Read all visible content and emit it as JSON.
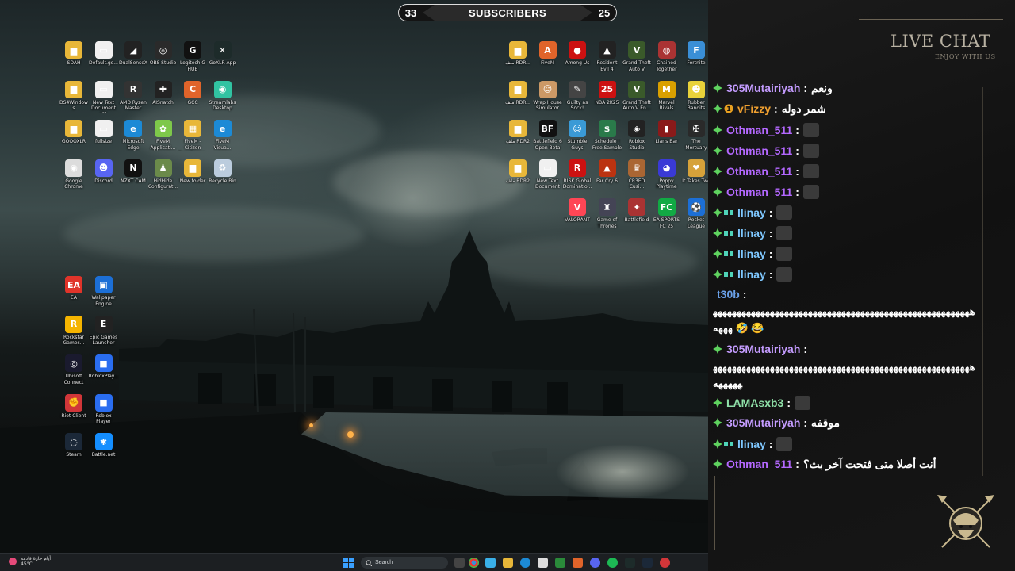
{
  "subscribers": {
    "left_count": "33",
    "label": "SUBSCRIBERS",
    "right_count": "25"
  },
  "desktop": {
    "left_icons": [
      {
        "label": "SDAH",
        "color": "#e8b739",
        "glyph": "▆"
      },
      {
        "label": "Default.go...",
        "color": "#f0f0f0",
        "glyph": "▭"
      },
      {
        "label": "DualSenseX",
        "color": "#222",
        "glyph": "◢"
      },
      {
        "label": "OBS Studio",
        "color": "#2a2a2a",
        "glyph": "◎"
      },
      {
        "label": "Logitech G HUB",
        "color": "#111",
        "glyph": "G"
      },
      {
        "label": "GoXLR App",
        "color": "#1d2b2a",
        "glyph": "✕"
      },
      {
        "label": "DS4Windows",
        "color": "#e8b739",
        "glyph": "▆"
      },
      {
        "label": "New Text Document (2)",
        "color": "#f0f0f0",
        "glyph": "▭"
      },
      {
        "label": "AMD Ryzen Master",
        "color": "#333",
        "glyph": "R"
      },
      {
        "label": "AISnatch",
        "color": "#222",
        "glyph": "✚"
      },
      {
        "label": "GCC",
        "color": "#e0642a",
        "glyph": "C"
      },
      {
        "label": "Streamlabs Desktop",
        "color": "#31c3a2",
        "glyph": "◉"
      },
      {
        "label": "GOOOXLR",
        "color": "#e8b739",
        "glyph": "▆"
      },
      {
        "label": "fullsize",
        "color": "#f0f0f0",
        "glyph": "▭"
      },
      {
        "label": "Microsoft Edge",
        "color": "#1c8ad6",
        "glyph": "e"
      },
      {
        "label": "FiveM Applicati...",
        "color": "#7ec84a",
        "glyph": "✿"
      },
      {
        "label": "FiveM - Citizen Developme...",
        "color": "#e8b739",
        "glyph": "▦"
      },
      {
        "label": "FiveM Visua...",
        "color": "#1c8ad6",
        "glyph": "e"
      },
      {
        "label": "Google Chrome",
        "color": "#dcdcdc",
        "glyph": "◉"
      },
      {
        "label": "Discord",
        "color": "#5865f2",
        "glyph": "☻"
      },
      {
        "label": "NZXT CAM",
        "color": "#111",
        "glyph": "N"
      },
      {
        "label": "HidHide Configurat...",
        "color": "#6b8a4a",
        "glyph": "♟"
      },
      {
        "label": "New folder",
        "color": "#e8b739",
        "glyph": "▆"
      },
      {
        "label": "Recycle Bin",
        "color": "#bcd",
        "glyph": "♻"
      }
    ],
    "launcher_icons": [
      {
        "label": "EA",
        "color": "#e0342a",
        "glyph": "EA"
      },
      {
        "label": "Wallpaper Engine",
        "color": "#1c6fd6",
        "glyph": "▣"
      },
      {
        "label": "Rockstar Games...",
        "color": "#f5b400",
        "glyph": "R"
      },
      {
        "label": "Epic Games Launcher",
        "color": "#222",
        "glyph": "E"
      },
      {
        "label": "Ubisoft Connect",
        "color": "#1a1a2e",
        "glyph": "◎"
      },
      {
        "label": "RobloxPlay...",
        "color": "#2a6df0",
        "glyph": "■"
      },
      {
        "label": "Riot Client",
        "color": "#d13639",
        "glyph": "✊"
      },
      {
        "label": "Roblox Player",
        "color": "#2a6df0",
        "glyph": "■"
      },
      {
        "label": "Steam",
        "color": "#1b2838",
        "glyph": "◌"
      },
      {
        "label": "Battle.net",
        "color": "#148eff",
        "glyph": "✱"
      }
    ],
    "right_icons": [
      {
        "label": "ملف RDR...",
        "color": "#e8b739",
        "glyph": "▆"
      },
      {
        "label": "FiveM",
        "color": "#e0642a",
        "glyph": "A"
      },
      {
        "label": "Among Us",
        "color": "#c11",
        "glyph": "●"
      },
      {
        "label": "Resident Evil 4",
        "color": "#222",
        "glyph": "▲"
      },
      {
        "label": "Grand Theft Auto V",
        "color": "#3a5a2a",
        "glyph": "V"
      },
      {
        "label": "Chained Together",
        "color": "#a33",
        "glyph": "◍"
      },
      {
        "label": "Fortnite",
        "color": "#3a8fd6",
        "glyph": "F"
      },
      {
        "label": "ملف RDR...",
        "color": "#e8b739",
        "glyph": "▆"
      },
      {
        "label": "Wrap House Simulator",
        "color": "#c96",
        "glyph": "☺"
      },
      {
        "label": "Guilty as Sock!",
        "color": "#444",
        "glyph": "✎"
      },
      {
        "label": "NBA 2K25",
        "color": "#c11",
        "glyph": "25"
      },
      {
        "label": "Grand Theft Auto V En...",
        "color": "#3a5a2a",
        "glyph": "V"
      },
      {
        "label": "Marvel Rivals",
        "color": "#d9a000",
        "glyph": "M"
      },
      {
        "label": "Rubber Bandits",
        "color": "#e8d23a",
        "glyph": "☻"
      },
      {
        "label": "ملف RDR2",
        "color": "#e8b739",
        "glyph": "▆"
      },
      {
        "label": "Battlefield 6 Open Beta",
        "color": "#111",
        "glyph": "BF"
      },
      {
        "label": "Stumble Guys",
        "color": "#3a9ad6",
        "glyph": "☺"
      },
      {
        "label": "Schedule I Free Sample",
        "color": "#2a7a4a",
        "glyph": "$"
      },
      {
        "label": "Roblox Studio",
        "color": "#222",
        "glyph": "◈"
      },
      {
        "label": "Liar's Bar",
        "color": "#8a1a1a",
        "glyph": "▮"
      },
      {
        "label": "The Mortuary Assistant",
        "color": "#2a2a2a",
        "glyph": "✠"
      },
      {
        "label": "ملف RDR2",
        "color": "#e8b739",
        "glyph": "▆"
      },
      {
        "label": "New Text Document",
        "color": "#f0f0f0",
        "glyph": "▭"
      },
      {
        "label": "RISK Global Dominatio...",
        "color": "#c11",
        "glyph": "R"
      },
      {
        "label": "Far Cry 6",
        "color": "#b31",
        "glyph": "▲"
      },
      {
        "label": "CR3ED Cusi...",
        "color": "#a63",
        "glyph": "♛"
      },
      {
        "label": "Poppy Playtime",
        "color": "#3a3ad6",
        "glyph": "◕"
      },
      {
        "label": "It Takes Two",
        "color": "#d6a23a",
        "glyph": "❤"
      },
      {
        "label": "VALORANT",
        "color": "#ff4655",
        "glyph": "V"
      },
      {
        "label": "Game of Thrones",
        "color": "#445",
        "glyph": "♜"
      },
      {
        "label": "Battlefield",
        "color": "#a33",
        "glyph": "✦"
      },
      {
        "label": "EA SPORTS FC 25",
        "color": "#1a4",
        "glyph": "FC"
      },
      {
        "label": "Rocket League",
        "color": "#1c6fd6",
        "glyph": "⚽"
      }
    ]
  },
  "chat": {
    "title": "LIVE CHAT",
    "subtitle": "ENJOY WITH US",
    "messages": [
      {
        "user": "305Mutairiyah",
        "color": "#c49cff",
        "text": "ونعم",
        "badge": "gem"
      },
      {
        "user": "vFizzy",
        "color": "#f0a030",
        "text": "شمر دوله",
        "badge": "gem-gold"
      },
      {
        "user": "Othman_511",
        "color": "#b468ff",
        "text": "",
        "badge": "gem",
        "emote": true
      },
      {
        "user": "Othman_511",
        "color": "#b468ff",
        "text": "",
        "badge": "gem",
        "emote": true
      },
      {
        "user": "Othman_511",
        "color": "#b468ff",
        "text": "",
        "badge": "gem",
        "emote": true
      },
      {
        "user": "Othman_511",
        "color": "#b468ff",
        "text": "",
        "badge": "gem",
        "emote": true
      },
      {
        "user": "llinay",
        "color": "#7fc8ff",
        "text": "",
        "badge": "gem-glasses",
        "emote": true
      },
      {
        "user": "llinay",
        "color": "#7fc8ff",
        "text": "",
        "badge": "gem-glasses",
        "emote": true
      },
      {
        "user": "llinay",
        "color": "#7fc8ff",
        "text": "",
        "badge": "gem-glasses",
        "emote": true
      },
      {
        "user": "llinay",
        "color": "#7fc8ff",
        "text": "",
        "badge": "gem-glasses",
        "emote": true
      },
      {
        "user": "t30b",
        "color": "#6aa0e8",
        "text": "",
        "badge": "none"
      }
    ],
    "t30b_body": "ههههههههههههههههههههههههههههههههههههههههههههههههههههههههههه 🤣 😂",
    "mut_user": "305Mutairiyah",
    "mut_body": "ههههههههههههههههههههههههههههههههههههههههههههههههههههههههههههه",
    "tail": [
      {
        "user": "LAMAsxb3",
        "color": "#8fe0a8",
        "text": "",
        "badge": "gem",
        "emote": true
      },
      {
        "user": "305Mutairiyah",
        "color": "#c49cff",
        "text": "موقفه",
        "badge": "gem"
      },
      {
        "user": "llinay",
        "color": "#7fc8ff",
        "text": "",
        "badge": "gem-glasses",
        "emote": true
      },
      {
        "user": "Othman_511",
        "color": "#b468ff",
        "text": "أنت أصلا متى فتحت آخر بث؟",
        "badge": "gem"
      }
    ]
  },
  "taskbar": {
    "weather_line1": "أيام حارة قادمة",
    "weather_line2": "45°C",
    "search_placeholder": "Search"
  },
  "colors": {
    "accent_green": "#5fd35f",
    "chat_bg": "#141414",
    "frame": "#6b6354"
  }
}
